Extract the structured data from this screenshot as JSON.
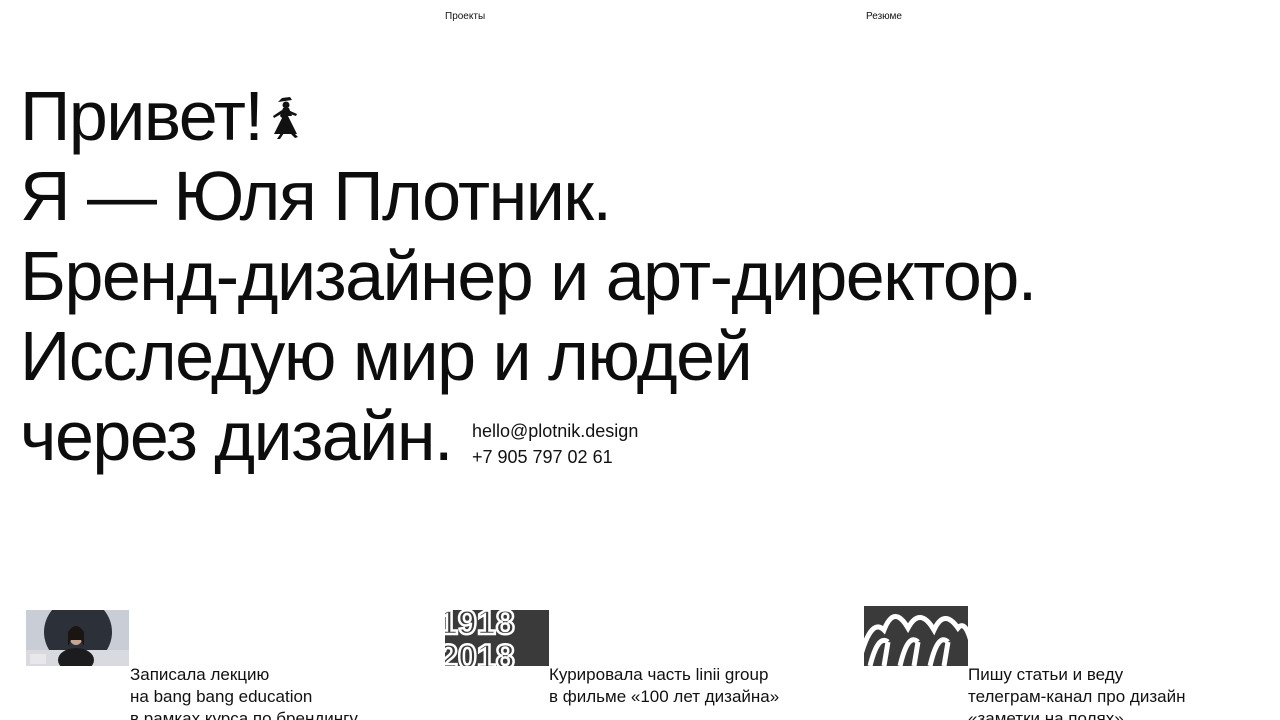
{
  "nav": {
    "projects": "Проекты",
    "resume": "Резюме"
  },
  "hero": {
    "line1": "Привет!",
    "line2": "Я — Юля Плотник.",
    "line3": "Бренд-дизайнер и арт-директор.",
    "line4": "Исследую мир и людей",
    "line5": "через дизайн.",
    "figure_icon": "walking-woman-icon"
  },
  "contacts": {
    "email": "hello@plotnik.design",
    "phone": "+7 905 797 02 61"
  },
  "cards": [
    {
      "thumb": "lecture-photo",
      "lines": [
        "Записала лекцию",
        "на bang bang education",
        "в рамках курса по брендингу"
      ]
    },
    {
      "thumb": "1918-2018-graphic",
      "lines": [
        "Курировала часть linii group",
        "в фильме «100 лет дизайна»"
      ]
    },
    {
      "thumb": "arches-graphic",
      "lines": [
        "Пишу статьи и веду",
        "телеграм-канал про дизайн",
        "«заметки на полях»"
      ]
    }
  ],
  "colors": {
    "background": "#ffffff",
    "text": "#111111",
    "thumb_dark": "#3a3a3a"
  }
}
